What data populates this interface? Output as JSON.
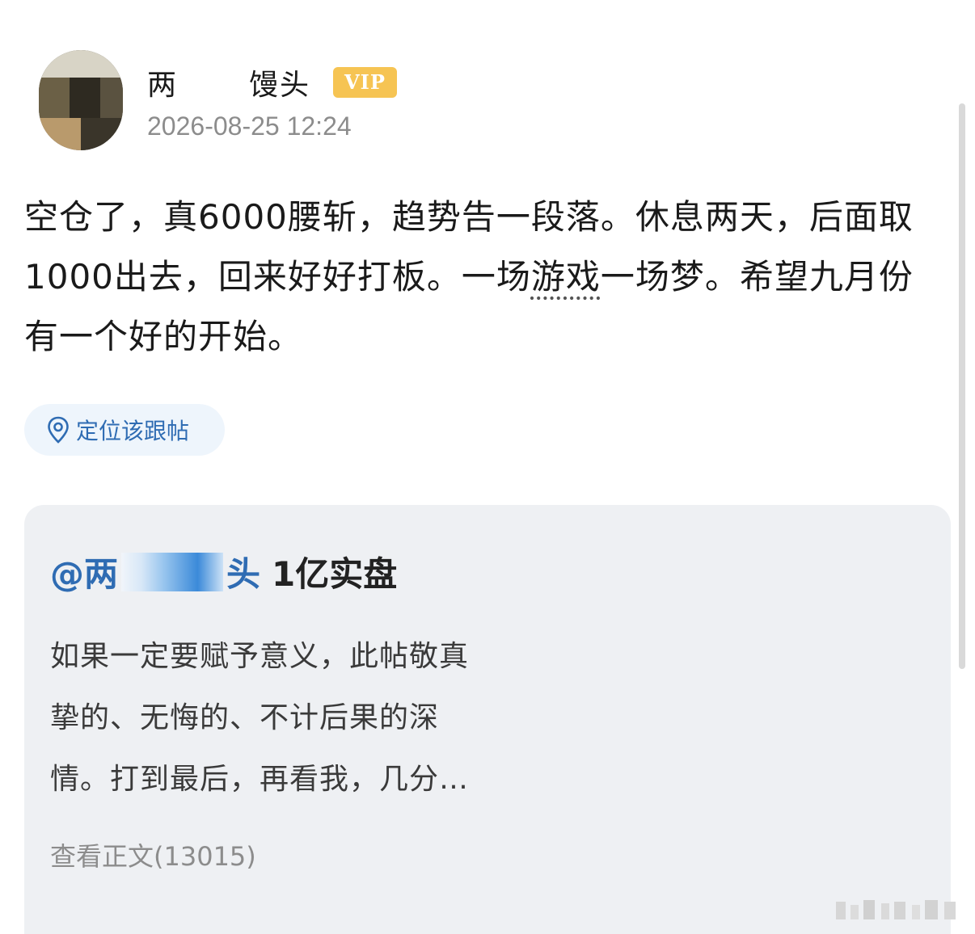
{
  "author": {
    "name_visible_prefix": "两",
    "name_visible_suffix": "馒头",
    "badge": "VIP",
    "timestamp": "2026-08-25 12:24"
  },
  "post": {
    "text_before_link": "空仓了，真6000腰斩，趋势告一段落。休息两天，后面取1000出去，回来好好打板。一场",
    "link_word": "游戏",
    "text_after_link": "一场梦。希望九月份有一个好的开始。"
  },
  "locate": {
    "label": "定位该跟帖",
    "icon": "location-pin-icon"
  },
  "quote": {
    "mention_prefix": "@两",
    "mention_suffix": "头",
    "tag": "1亿实盘",
    "body_lines": [
      "如果一定要赋予意义，此帖敬真",
      "挚的、无悔的、不计后果的深",
      "情。打到最后，再看我，几分…"
    ],
    "view_full": "查看正文(13015)"
  },
  "colors": {
    "link_blue": "#2f6cb3",
    "vip_gold": "#f6c453",
    "card_bg": "#eef0f3",
    "pill_bg": "#eef5fc",
    "muted": "#8c8c8c"
  }
}
